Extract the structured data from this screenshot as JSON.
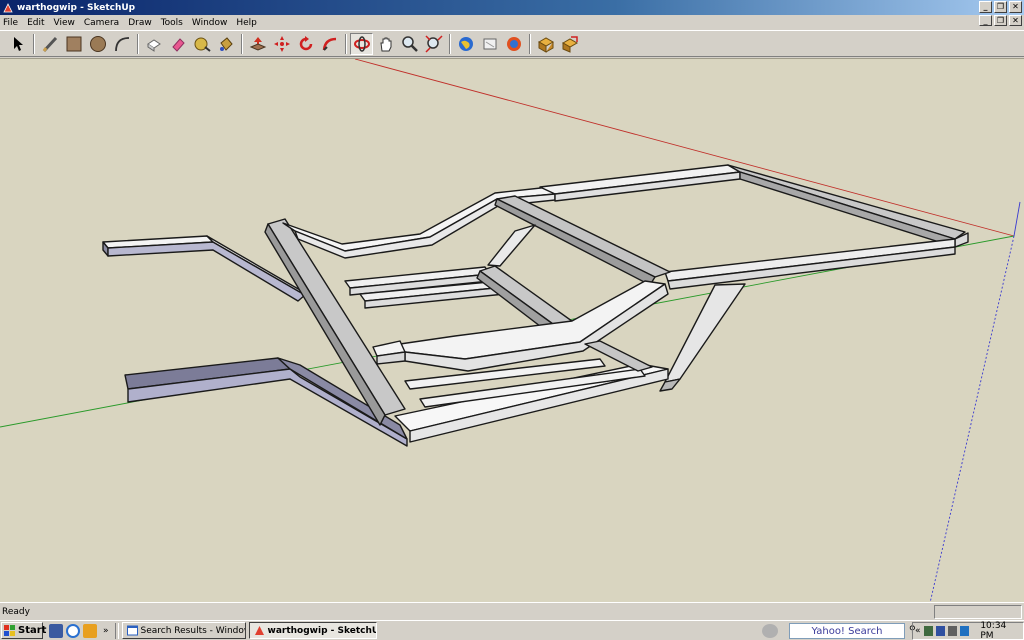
{
  "window": {
    "title": "warthogwip - SketchUp",
    "controls": {
      "minimize": "_",
      "restore": "❐",
      "close": "✕"
    }
  },
  "menu": {
    "items": [
      "File",
      "Edit",
      "View",
      "Camera",
      "Draw",
      "Tools",
      "Window",
      "Help"
    ]
  },
  "toolbar": {
    "tools": [
      {
        "name": "select-tool-icon"
      },
      {
        "name": "line-tool-icon"
      },
      {
        "name": "rectangle-tool-icon"
      },
      {
        "name": "circle-tool-icon"
      },
      {
        "name": "arc-tool-icon"
      },
      {
        "name": "make-component-icon"
      },
      {
        "name": "eraser-tool-icon"
      },
      {
        "name": "tape-measure-icon"
      },
      {
        "name": "paint-bucket-icon"
      },
      {
        "name": "push-pull-icon"
      },
      {
        "name": "move-tool-icon"
      },
      {
        "name": "rotate-tool-icon"
      },
      {
        "name": "follow-me-icon"
      },
      {
        "name": "orbit-tool-icon"
      },
      {
        "name": "pan-tool-icon"
      },
      {
        "name": "zoom-tool-icon"
      },
      {
        "name": "zoom-extents-icon"
      },
      {
        "name": "google-earth-icon"
      },
      {
        "name": "get-models-icon"
      },
      {
        "name": "share-model-icon"
      },
      {
        "name": "components-icon"
      },
      {
        "name": "share-component-icon"
      }
    ]
  },
  "status": {
    "text": "Ready"
  },
  "taskbar": {
    "start_label": "Start",
    "quicklaunch_more": "»",
    "tasks": [
      {
        "label": "Search Results - Window...",
        "active": false
      },
      {
        "label": "warthogwip - SketchUp",
        "active": true
      }
    ],
    "search_label": "Yahoo! Search",
    "tray_more": "«",
    "clock": "10:34 PM"
  },
  "colors": {
    "viewport_bg": "#d9d5c0",
    "axis_red": "#c0302a",
    "axis_green": "#2a9a2a",
    "axis_blue": "#3a3ad0",
    "titlebar": "#0a246a"
  }
}
